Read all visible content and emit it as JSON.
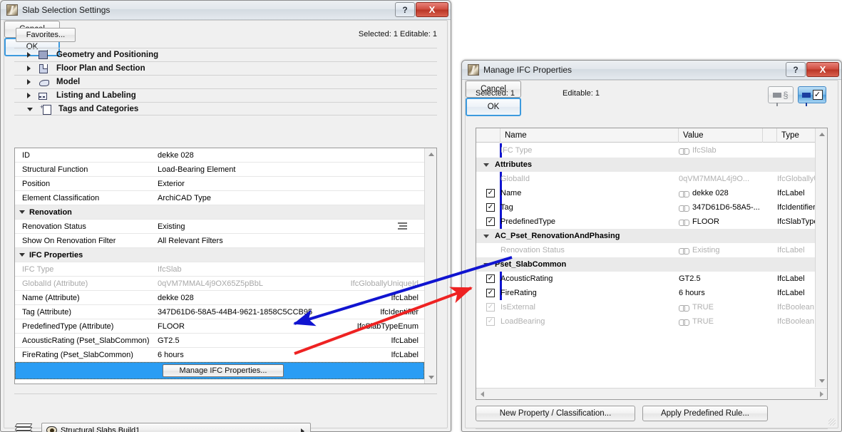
{
  "left_dialog": {
    "title": "Slab Selection Settings",
    "title_icon": "archicad-logo-icon",
    "help_label": "?",
    "close_label": "X",
    "favorites_label": "Favorites...",
    "selection_info": "Selected: 1 Editable: 1",
    "categories": [
      {
        "label": "Geometry and Positioning",
        "expanded": false,
        "icon": "geometry-icon"
      },
      {
        "label": "Floor Plan and Section",
        "expanded": false,
        "icon": "floorplan-icon"
      },
      {
        "label": "Model",
        "expanded": false,
        "icon": "model-icon"
      },
      {
        "label": "Listing and Labeling",
        "expanded": false,
        "icon": "listing-icon"
      },
      {
        "label": "Tags and Categories",
        "expanded": true,
        "icon": "tags-icon"
      }
    ],
    "properties": [
      {
        "kind": "row",
        "name": "ID",
        "value": "dekke 028",
        "type": "",
        "dim": false
      },
      {
        "kind": "row",
        "name": "Structural Function",
        "value": "Load-Bearing Element",
        "type": "",
        "dim": false
      },
      {
        "kind": "row",
        "name": "Position",
        "value": "Exterior",
        "type": "",
        "dim": false
      },
      {
        "kind": "row",
        "name": "Element Classification",
        "value": "ArchiCAD Type",
        "type": "",
        "dim": false
      },
      {
        "kind": "group",
        "name": "Renovation",
        "value": "",
        "type": "",
        "dim": false
      },
      {
        "kind": "row",
        "name": "Renovation Status",
        "value": "Existing",
        "type": "",
        "dim": false,
        "trailing_icon": "brick-pattern-icon"
      },
      {
        "kind": "row",
        "name": "Show On Renovation Filter",
        "value": "All Relevant Filters",
        "type": "",
        "dim": false
      },
      {
        "kind": "group",
        "name": "IFC Properties",
        "value": "",
        "type": "",
        "dim": false
      },
      {
        "kind": "row",
        "name": "IFC Type",
        "value": "IfcSlab",
        "type": "",
        "dim": true
      },
      {
        "kind": "row",
        "name": "GlobalId (Attribute)",
        "value": "0qVM7MMAL4j9OX65Z5pBbL",
        "type": "IfcGloballyUniqueId",
        "dim": true
      },
      {
        "kind": "row",
        "name": "Name (Attribute)",
        "value": "dekke 028",
        "type": "IfcLabel",
        "dim": false
      },
      {
        "kind": "row",
        "name": "Tag (Attribute)",
        "value": "347D61D6-58A5-44B4-9621-1858C5CCB95",
        "type": "IfcIdentifier",
        "dim": false
      },
      {
        "kind": "row",
        "name": "PredefinedType (Attribute)",
        "value": "FLOOR",
        "type": "IfcSlabTypeEnum",
        "dim": false
      },
      {
        "kind": "row",
        "name": "AcousticRating (Pset_SlabCommon)",
        "value": "GT2.5",
        "type": "IfcLabel",
        "dim": false
      },
      {
        "kind": "row",
        "name": "FireRating (Pset_SlabCommon)",
        "value": "6 hours",
        "type": "IfcLabel",
        "dim": false
      }
    ],
    "manage_button_label": "Manage IFC Properties...",
    "layer_combo_value": "Structural Slabs.Build1",
    "cancel_label": "Cancel",
    "ok_label": "OK"
  },
  "right_dialog": {
    "title": "Manage IFC Properties",
    "title_icon": "archicad-logo-icon",
    "help_label": "?",
    "close_label": "X",
    "selected_label": "Selected: 1",
    "editable_label": "Editable: 1",
    "filter_buttons": [
      {
        "name": "filter-rules-button",
        "active": false
      },
      {
        "name": "filter-checked-button",
        "active": true
      }
    ],
    "columns": [
      "",
      "Name",
      "Value",
      "Type"
    ],
    "rows": [
      {
        "kind": "row",
        "checkbox": "none",
        "name": "IFC Type",
        "value": "IfcSlab",
        "value_icon": "chain-link-icon",
        "type": "",
        "dim": true
      },
      {
        "kind": "group",
        "checkbox": "none",
        "name": "Attributes",
        "value": "",
        "value_icon": "",
        "type": "",
        "dim": false
      },
      {
        "kind": "row",
        "checkbox": "none",
        "name": "GlobalId",
        "value": "0qVM7MMAL4j9O...",
        "value_icon": "",
        "type": "IfcGloballyUniqueId",
        "dim": true
      },
      {
        "kind": "row",
        "checkbox": "checked",
        "name": "Name",
        "value": "dekke 028",
        "value_icon": "chain-link-icon",
        "type": "IfcLabel",
        "dim": false
      },
      {
        "kind": "row",
        "checkbox": "checked",
        "name": "Tag",
        "value": "347D61D6-58A5-...",
        "value_icon": "chain-link-icon",
        "type": "IfcIdentifier",
        "dim": false
      },
      {
        "kind": "row",
        "checkbox": "checked",
        "name": "PredefinedType",
        "value": "FLOOR",
        "value_icon": "chain-link-icon",
        "type": "IfcSlabTypeEnum",
        "dim": false
      },
      {
        "kind": "group",
        "checkbox": "none",
        "name": "AC_Pset_RenovationAndPhasing",
        "value": "",
        "value_icon": "",
        "type": "",
        "dim": false
      },
      {
        "kind": "row",
        "checkbox": "none",
        "name": "Renovation Status",
        "value": "Existing",
        "value_icon": "chain-link-icon",
        "type": "IfcLabel",
        "dim": true
      },
      {
        "kind": "group",
        "checkbox": "none",
        "name": "Pset_SlabCommon",
        "value": "",
        "value_icon": "",
        "type": "",
        "dim": false
      },
      {
        "kind": "row",
        "checkbox": "checked",
        "name": "AcousticRating",
        "value": "GT2.5",
        "value_icon": "",
        "type": "IfcLabel",
        "dim": false
      },
      {
        "kind": "row",
        "checkbox": "checked",
        "name": "FireRating",
        "value": "6 hours",
        "value_icon": "",
        "type": "IfcLabel",
        "dim": false
      },
      {
        "kind": "row",
        "checkbox": "checked-dim",
        "name": "IsExternal",
        "value": "TRUE",
        "value_icon": "chain-link-icon",
        "type": "IfcBoolean",
        "dim": true
      },
      {
        "kind": "row",
        "checkbox": "checked-dim",
        "name": "LoadBearing",
        "value": "TRUE",
        "value_icon": "chain-link-icon",
        "type": "IfcBoolean",
        "dim": true
      }
    ],
    "new_property_label": "New Property / Classification...",
    "apply_rule_label": "Apply Predefined Rule...",
    "cancel_label": "Cancel",
    "ok_label": "OK"
  },
  "annotations": {
    "blue_arrow": {
      "color": "#1014d0",
      "name": "blue-annotation-arrow"
    },
    "red_arrow": {
      "color": "#ee2222",
      "name": "red-annotation-arrow"
    }
  }
}
